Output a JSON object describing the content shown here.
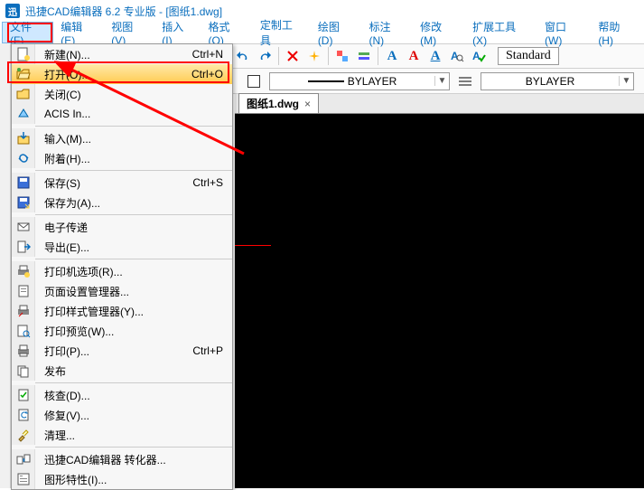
{
  "title": {
    "appIconLetter": "迅",
    "text": "迅捷CAD编辑器 6.2 专业版  - [图纸1.dwg]"
  },
  "menu": {
    "items": [
      {
        "label": "文件(F)",
        "active": true
      },
      {
        "label": "编辑(E)"
      },
      {
        "label": "视图(V)"
      },
      {
        "label": "插入(I)"
      },
      {
        "label": "格式(O)"
      },
      {
        "label": "定制工具"
      },
      {
        "label": "绘图(D)"
      },
      {
        "label": "标注(N)"
      },
      {
        "label": "修改(M)"
      },
      {
        "label": "扩展工具(X)"
      },
      {
        "label": "窗口(W)"
      },
      {
        "label": "帮助(H)"
      }
    ]
  },
  "fileMenu": {
    "groups": [
      [
        {
          "icon": "new-icon",
          "label": "新建(N)...",
          "shortcut": "Ctrl+N"
        },
        {
          "icon": "open-icon",
          "label": "打开(O)...",
          "shortcut": "Ctrl+O",
          "highlight": true
        },
        {
          "icon": "close-icon",
          "label": "关闭(C)"
        },
        {
          "icon": "acis-icon",
          "label": "ACIS In..."
        }
      ],
      [
        {
          "icon": "import-icon",
          "label": "输入(M)..."
        },
        {
          "icon": "attach-icon",
          "label": "附着(H)..."
        }
      ],
      [
        {
          "icon": "save-icon",
          "label": "保存(S)",
          "shortcut": "Ctrl+S"
        },
        {
          "icon": "saveas-icon",
          "label": "保存为(A)..."
        }
      ],
      [
        {
          "icon": "etransmit-icon",
          "label": "电子传递"
        },
        {
          "icon": "export-icon",
          "label": "导出(E)..."
        }
      ],
      [
        {
          "icon": "printer-opts-icon",
          "label": "打印机选项(R)..."
        },
        {
          "icon": "page-setup-icon",
          "label": "页面设置管理器..."
        },
        {
          "icon": "plot-style-icon",
          "label": "打印样式管理器(Y)..."
        },
        {
          "icon": "print-preview-icon",
          "label": "打印预览(W)..."
        },
        {
          "icon": "print-icon",
          "label": "打印(P)...",
          "shortcut": "Ctrl+P"
        },
        {
          "icon": "publish-icon",
          "label": "发布"
        }
      ],
      [
        {
          "icon": "audit-icon",
          "label": "核查(D)..."
        },
        {
          "icon": "recover-icon",
          "label": "修复(V)..."
        },
        {
          "icon": "purge-icon",
          "label": "清理..."
        }
      ],
      [
        {
          "icon": "convert-icon",
          "label": "迅捷CAD编辑器 转化器..."
        },
        {
          "icon": "props-icon",
          "label": "图形特性(I)..."
        }
      ]
    ]
  },
  "subbar": {
    "layerDropdown": "BYLAYER",
    "linetypeDropdown": "BYLAYER"
  },
  "toolbar": {
    "standardLabel": "Standard"
  },
  "tab": {
    "label": "图纸1.dwg",
    "close": "×"
  },
  "aa": {
    "blue": "A",
    "red": "A"
  }
}
